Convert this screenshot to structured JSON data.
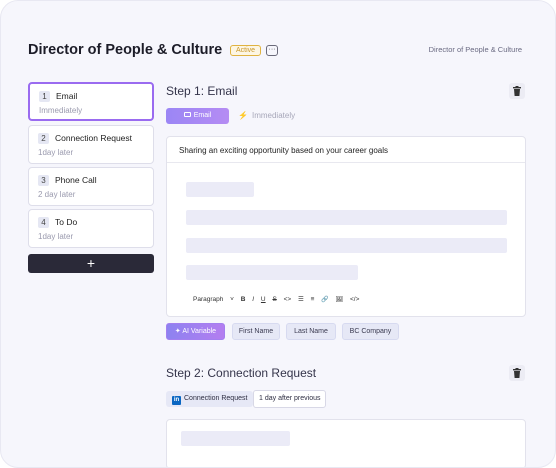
{
  "header": {
    "title": "Director of People & Culture",
    "status_badge": "Active",
    "more_label": "···",
    "right_label": "Director of People & Culture"
  },
  "sidebar": {
    "steps": [
      {
        "num": "1",
        "name": "Email",
        "sub": "Immediately"
      },
      {
        "num": "2",
        "name": "Connection Request",
        "sub": "1day later"
      },
      {
        "num": "3",
        "name": "Phone Call",
        "sub": "2 day later"
      },
      {
        "num": "4",
        "name": "To Do",
        "sub": "1day later"
      }
    ],
    "add_label": "+"
  },
  "step1": {
    "title": "Step 1: Email",
    "channel_label": "Email",
    "timing_label": "Immediately",
    "subject": "Sharing an exciting opportunity based on your career goals",
    "toolbar": {
      "paragraph": "Paragraph",
      "bold": "B",
      "italic": "I",
      "underline": "U",
      "strike": "S",
      "code": "<>",
      "bullets": "☰",
      "numbered": "≡",
      "link": "🔗",
      "image": "🖼",
      "html": "</>"
    },
    "chips": [
      "AI Variable",
      "First Name",
      "Last Name",
      "BC Company"
    ]
  },
  "step2": {
    "title": "Step 2: Connection Request",
    "channel_label": "Connection Request",
    "timing_label": "1 day after previous"
  },
  "icons": {
    "trash": "trash-icon",
    "mail": "mail-icon",
    "bolt": "bolt-icon",
    "sparkle": "sparkle-icon",
    "linkedin": "linkedin-icon"
  },
  "colors": {
    "accent": "#9a6bf0",
    "badge": "#e0b341",
    "add_button": "#2a2938",
    "linkedin": "#0a66c2"
  }
}
